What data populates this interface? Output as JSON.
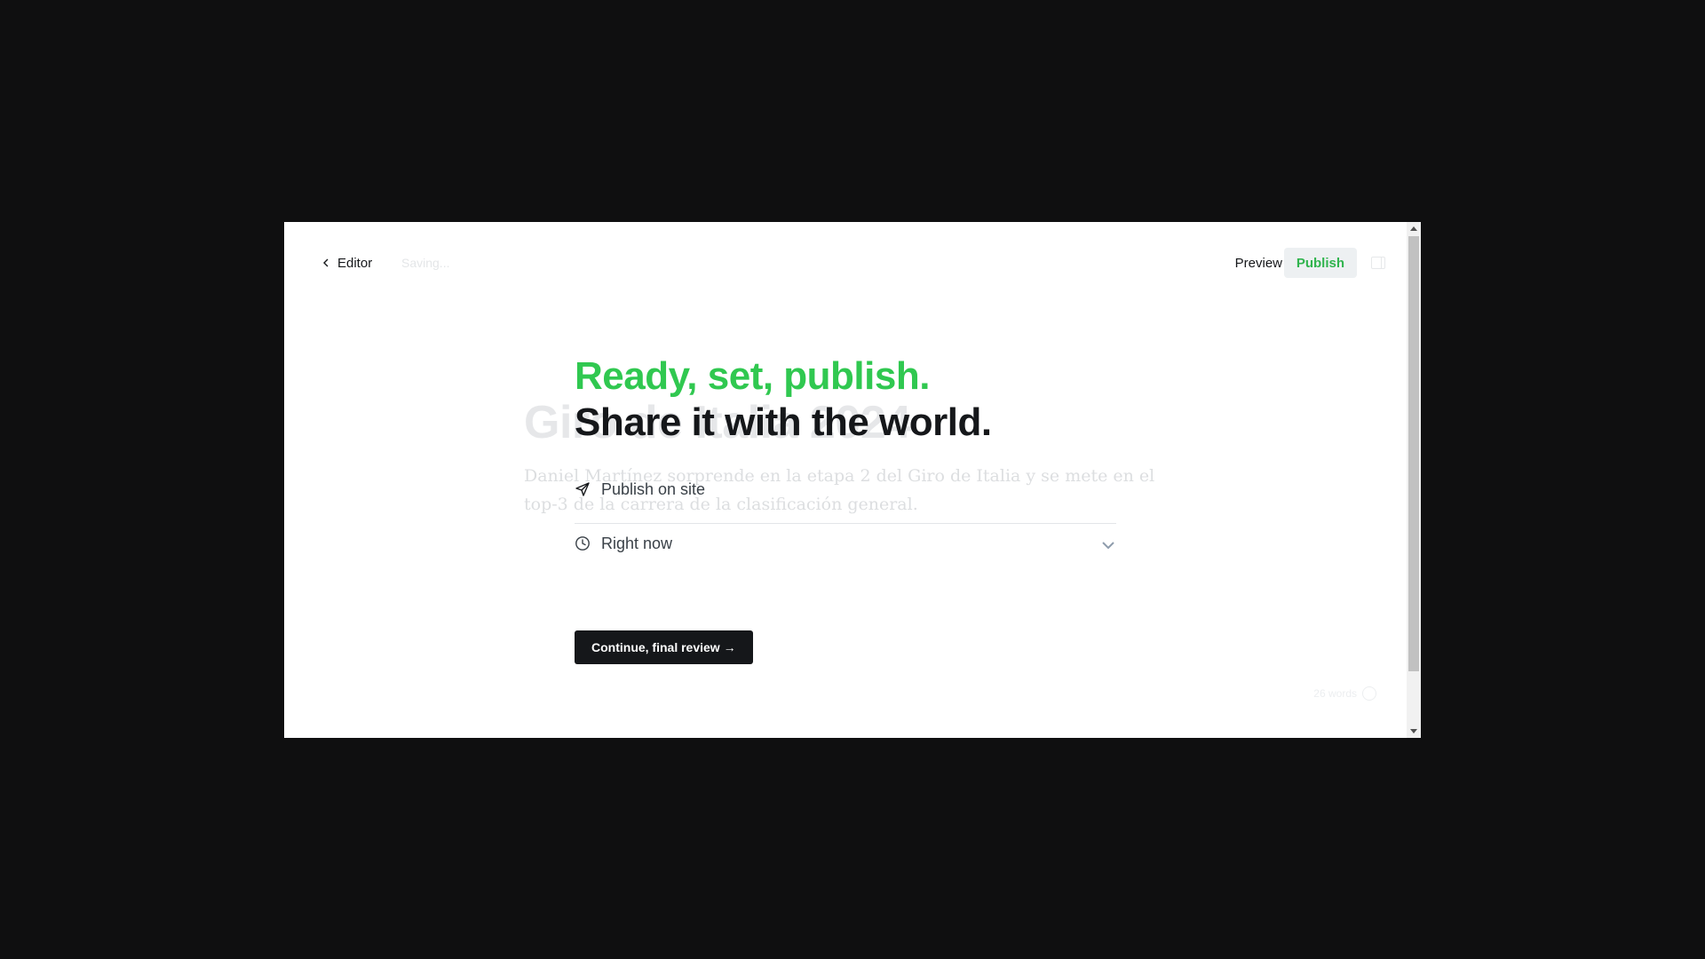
{
  "topbar": {
    "back_label": "Editor",
    "saving_label": "Saving...",
    "preview_label": "Preview",
    "publish_label": "Publish"
  },
  "editor": {
    "title": "Giro de Italia 2024",
    "excerpt": "Daniel Martínez sorprende en la etapa 2 del Giro de Italia y se mete en el top-3 de la carrera de la clasificación general.",
    "word_count": "26 words"
  },
  "publish_flow": {
    "headline_1": "Ready, set, publish.",
    "headline_2": "Share it with the world.",
    "publish_option": "Publish on site",
    "schedule_option": "Right now",
    "continue_label": "Continue, final review →"
  },
  "colors": {
    "accent_green": "#30c850",
    "dark": "#15171a"
  }
}
